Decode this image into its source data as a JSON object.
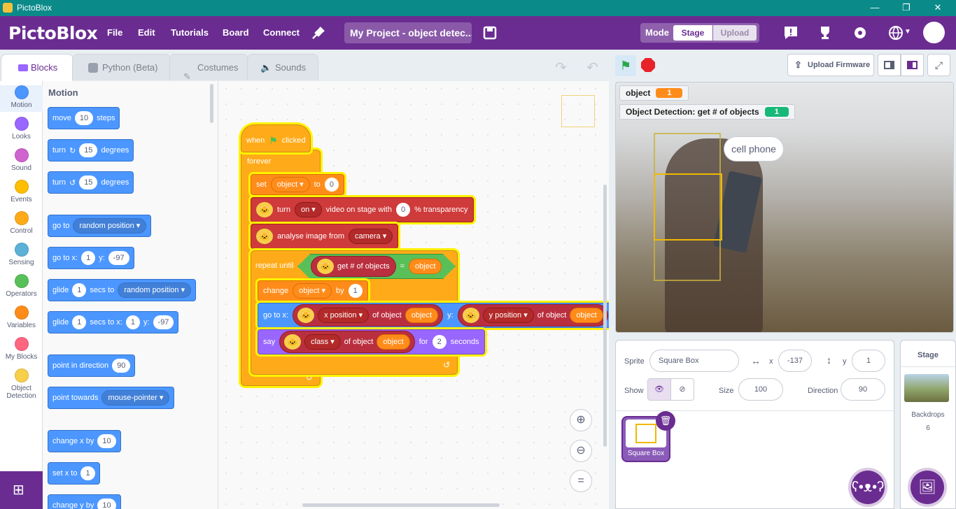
{
  "window": {
    "title": "PictoBlox",
    "minimize": "—",
    "maximize": "❐",
    "close": "✕"
  },
  "menubar": {
    "logo": "PictoBlox",
    "menus": [
      "File",
      "Edit",
      "Tutorials",
      "Board",
      "Connect"
    ],
    "project_name": "My Project - object detec...",
    "mode_label": "Mode",
    "mode_stage": "Stage",
    "mode_upload": "Upload"
  },
  "tabs": {
    "blocks": "Blocks",
    "python": "Python (Beta)",
    "costumes": "Costumes",
    "sounds": "Sounds"
  },
  "categories": [
    {
      "label": "Motion",
      "color": "#4c97ff"
    },
    {
      "label": "Looks",
      "color": "#9966ff"
    },
    {
      "label": "Sound",
      "color": "#cf63cf"
    },
    {
      "label": "Events",
      "color": "#ffbf00"
    },
    {
      "label": "Control",
      "color": "#ffab19"
    },
    {
      "label": "Sensing",
      "color": "#5cb1d6"
    },
    {
      "label": "Operators",
      "color": "#59c059"
    },
    {
      "label": "Variables",
      "color": "#ff8c1a"
    },
    {
      "label": "My Blocks",
      "color": "#ff6680"
    },
    {
      "label": "Object Detection",
      "color": "#f8cf4a"
    }
  ],
  "palette": {
    "heading": "Motion",
    "move": {
      "a": "move",
      "v": "10",
      "b": "steps"
    },
    "turn_cw": {
      "a": "turn",
      "v": "15",
      "b": "degrees"
    },
    "turn_ccw": {
      "a": "turn",
      "v": "15",
      "b": "degrees"
    },
    "goto": {
      "a": "go to",
      "v": "random position"
    },
    "gotoxy": {
      "a": "go to x:",
      "x": "1",
      "b": "y:",
      "y": "-97"
    },
    "glide1": {
      "a": "glide",
      "v": "1",
      "b": "secs to",
      "c": "random position"
    },
    "glide2": {
      "a": "glide",
      "v": "1",
      "b": "secs to x:",
      "x": "1",
      "c": "y:",
      "y": "-97"
    },
    "point_dir": {
      "a": "point in direction",
      "v": "90"
    },
    "point_towards": {
      "a": "point towards",
      "v": "mouse-pointer"
    },
    "change_x": {
      "a": "change x by",
      "v": "10"
    },
    "set_x": {
      "a": "set x to",
      "v": "1"
    },
    "change_y": {
      "a": "change y by",
      "v": "10"
    }
  },
  "script": {
    "when": "when",
    "clicked": "clicked",
    "forever": "forever",
    "set": {
      "a": "set",
      "var": "object",
      "b": "to",
      "v": "0"
    },
    "turn_video": {
      "a": "turn",
      "state": "on",
      "b": "video on stage with",
      "v": "0",
      "c": "% transparency"
    },
    "analyse": {
      "a": "analyse image from",
      "src": "camera"
    },
    "repeat_until": {
      "a": "repeat until",
      "b": "get # of objects",
      "eq": "=",
      "var": "object"
    },
    "change": {
      "a": "change",
      "var": "object",
      "b": "by",
      "v": "1"
    },
    "goto": {
      "a": "go to x:",
      "xp": "x position",
      "of1": "of object",
      "var1": "object",
      "y": "y:",
      "yp": "y position",
      "of2": "of object",
      "var2": "object"
    },
    "say": {
      "a": "say",
      "cls": "class",
      "of": "of object",
      "var": "object",
      "for": "for",
      "v": "2",
      "secs": "seconds"
    }
  },
  "stage_header": {
    "upload_firmware": "Upload Firmware"
  },
  "stage": {
    "monitor1": {
      "label": "object",
      "value": "1"
    },
    "monitor2": {
      "label": "Object Detection: get # of objects",
      "value": "1"
    },
    "speech": "cell phone",
    "colors": {
      "var_orange": "#ff8c1a",
      "var_green": "#17b978",
      "box": "#f2b800"
    }
  },
  "sprite_info": {
    "sprite_label": "Sprite",
    "sprite_name": "Square Box",
    "x_label": "x",
    "x": "-137",
    "y_label": "y",
    "y": "1",
    "show_label": "Show",
    "size_label": "Size",
    "size": "100",
    "direction_label": "Direction",
    "direction": "90",
    "thumb_label": "Square Box"
  },
  "stage_col": {
    "title": "Stage",
    "backdrops_label": "Backdrops",
    "backdrops_count": "6"
  }
}
